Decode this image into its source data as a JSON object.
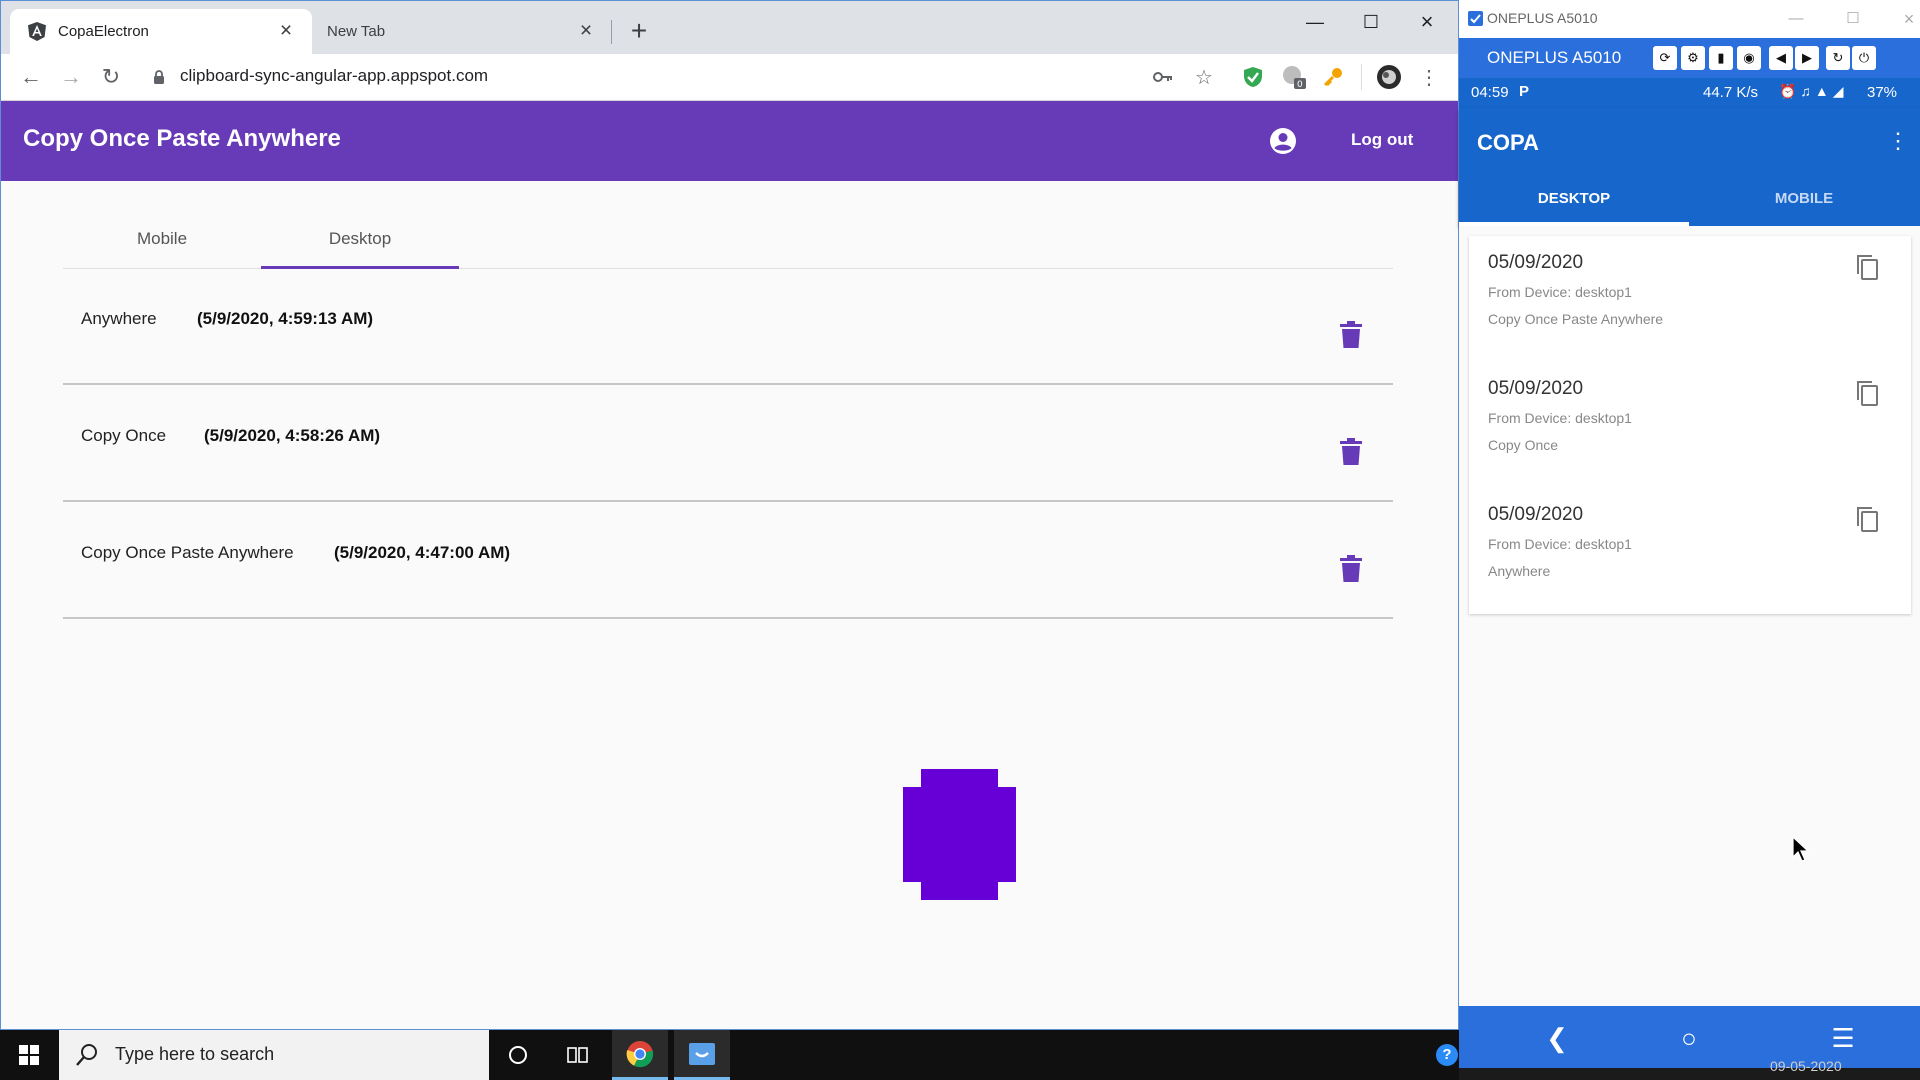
{
  "browser": {
    "tabs": [
      {
        "title": "CopaElectron",
        "active": true
      },
      {
        "title": "New Tab",
        "active": false
      }
    ],
    "url": "clipboard-sync-angular-app.appspot.com"
  },
  "app": {
    "title": "Copy Once Paste Anywhere",
    "logout_label": "Log out",
    "tabs": [
      {
        "label": "Mobile",
        "active": false
      },
      {
        "label": "Desktop",
        "active": true
      }
    ],
    "entries": [
      {
        "text": "Anywhere",
        "timestamp": "(5/9/2020, 4:59:13 AM)"
      },
      {
        "text": "Copy Once",
        "timestamp": "(5/9/2020, 4:58:26 AM)"
      },
      {
        "text": "Copy Once Paste Anywhere",
        "timestamp": "(5/9/2020, 4:47:00 AM)"
      }
    ],
    "accent_color": "#673ab7"
  },
  "phone": {
    "window_title": "ONEPLUS A5010",
    "device_name": "ONEPLUS A5010",
    "status": {
      "time": "04:59",
      "carrier_glyph": "P",
      "speed": "44.7 K/s",
      "battery": "37%"
    },
    "app_title": "COPA",
    "tabs": [
      {
        "label": "DESKTOP",
        "active": true
      },
      {
        "label": "MOBILE",
        "active": false
      }
    ],
    "clips": [
      {
        "date": "05/09/2020",
        "from": "From Device: desktop1",
        "content": "Copy Once Paste Anywhere"
      },
      {
        "date": "05/09/2020",
        "from": "From Device: desktop1",
        "content": "Copy Once"
      },
      {
        "date": "05/09/2020",
        "from": "From Device: desktop1",
        "content": "Anywhere"
      }
    ],
    "accent_color": "#1766cc"
  },
  "taskbar": {
    "search_placeholder": "Type here to search",
    "clock_date": "09-05-2020"
  }
}
